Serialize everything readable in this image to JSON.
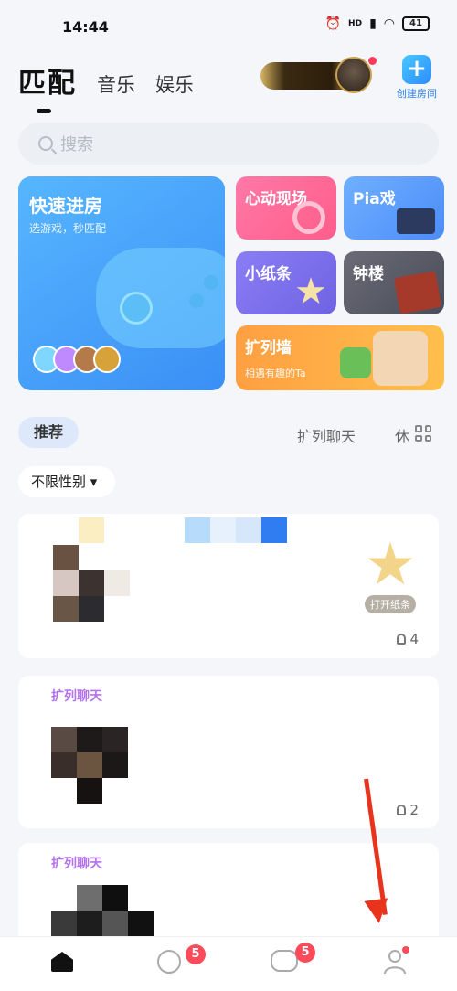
{
  "status_bar": {
    "time": "14:44",
    "battery": "41",
    "hd_label": "HD"
  },
  "top_tabs": {
    "active": "匹配",
    "tabs": [
      "音乐",
      "娱乐"
    ]
  },
  "header": {
    "create_room_label": "创建房间"
  },
  "search": {
    "placeholder": "搜索"
  },
  "quick_join": {
    "title": "快速进房",
    "subtitle": "选游戏，秒匹配"
  },
  "cards": {
    "heart": {
      "title": "心动现场"
    },
    "pia": {
      "title": "Pia戏"
    },
    "note": {
      "title": "小纸条"
    },
    "tower": {
      "title": "钟楼"
    },
    "wall": {
      "title": "扩列墙",
      "subtitle": "相遇有趣的Ta"
    }
  },
  "section": {
    "active_tab": "推荐",
    "right_tab": "扩列聊天",
    "right_tab2": "休"
  },
  "filter": {
    "label": "不限性别 ▾"
  },
  "rooms": [
    {
      "tag": "",
      "count": "4",
      "action": "打开纸条"
    },
    {
      "tag": "扩列聊天",
      "count": "2"
    },
    {
      "tag": "扩列聊天"
    }
  ],
  "bottom_nav": {
    "compass_badge": "5",
    "chat_badge": "5"
  },
  "colors": {
    "accent": "#2d8cff",
    "badge": "#ff4a5a",
    "tag_purple": "#b472ef",
    "arrow": "#e8341c"
  }
}
